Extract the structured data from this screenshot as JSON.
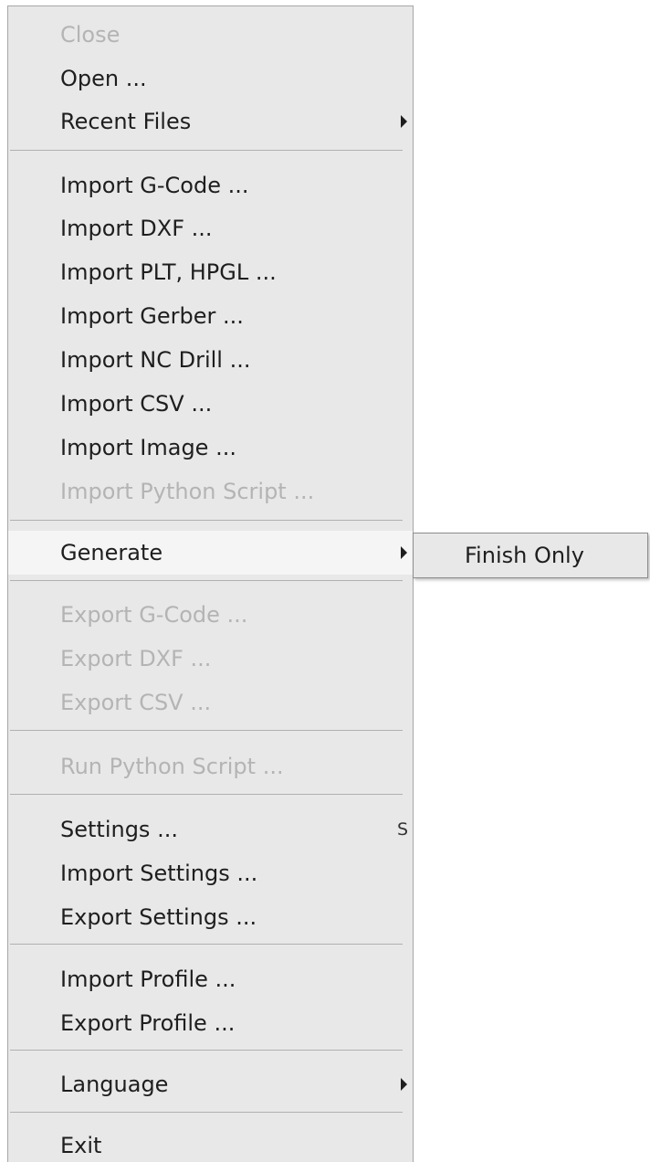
{
  "menu": {
    "items": [
      {
        "label": "Close",
        "enabled": false
      },
      {
        "label": "Open ...",
        "enabled": true
      },
      {
        "label": "Recent Files",
        "enabled": true,
        "submenu_arrow": "chevron-right-icon"
      },
      {
        "label": "Import G-Code ...",
        "enabled": true
      },
      {
        "label": "Import DXF ...",
        "enabled": true
      },
      {
        "label": "Import PLT, HPGL ...",
        "enabled": true
      },
      {
        "label": "Import Gerber ...",
        "enabled": true
      },
      {
        "label": "Import NC Drill ...",
        "enabled": true
      },
      {
        "label": "Import CSV ...",
        "enabled": true
      },
      {
        "label": "Import Image ...",
        "enabled": true
      },
      {
        "label": "Import Python Script ...",
        "enabled": false
      },
      {
        "label": "Generate",
        "enabled": true,
        "highlighted": true,
        "submenu_arrow": "chevron-right-icon"
      },
      {
        "label": "Export G-Code ...",
        "enabled": false
      },
      {
        "label": "Export DXF ...",
        "enabled": false
      },
      {
        "label": "Export CSV ...",
        "enabled": false
      },
      {
        "label": "Run Python Script ...",
        "enabled": false
      },
      {
        "label": "Settings ...",
        "enabled": true,
        "shortcut": "S"
      },
      {
        "label": "Import Settings ...",
        "enabled": true
      },
      {
        "label": "Export Settings ...",
        "enabled": true
      },
      {
        "label": "Import Profile ...",
        "enabled": true
      },
      {
        "label": "Export Profile ...",
        "enabled": true
      },
      {
        "label": "Language",
        "enabled": true,
        "submenu_arrow": "chevron-right-icon"
      },
      {
        "label": "Exit",
        "enabled": true
      }
    ]
  },
  "generate_submenu": {
    "items": [
      {
        "label": "Finish Only",
        "enabled": true
      }
    ]
  },
  "colors": {
    "menu_background": "#e8e8e8",
    "highlight_background": "#f5f5f5",
    "enabled_text": "#1e1e1e",
    "disabled_text": "#b4b4b4",
    "separator": "#b0b0b0"
  }
}
